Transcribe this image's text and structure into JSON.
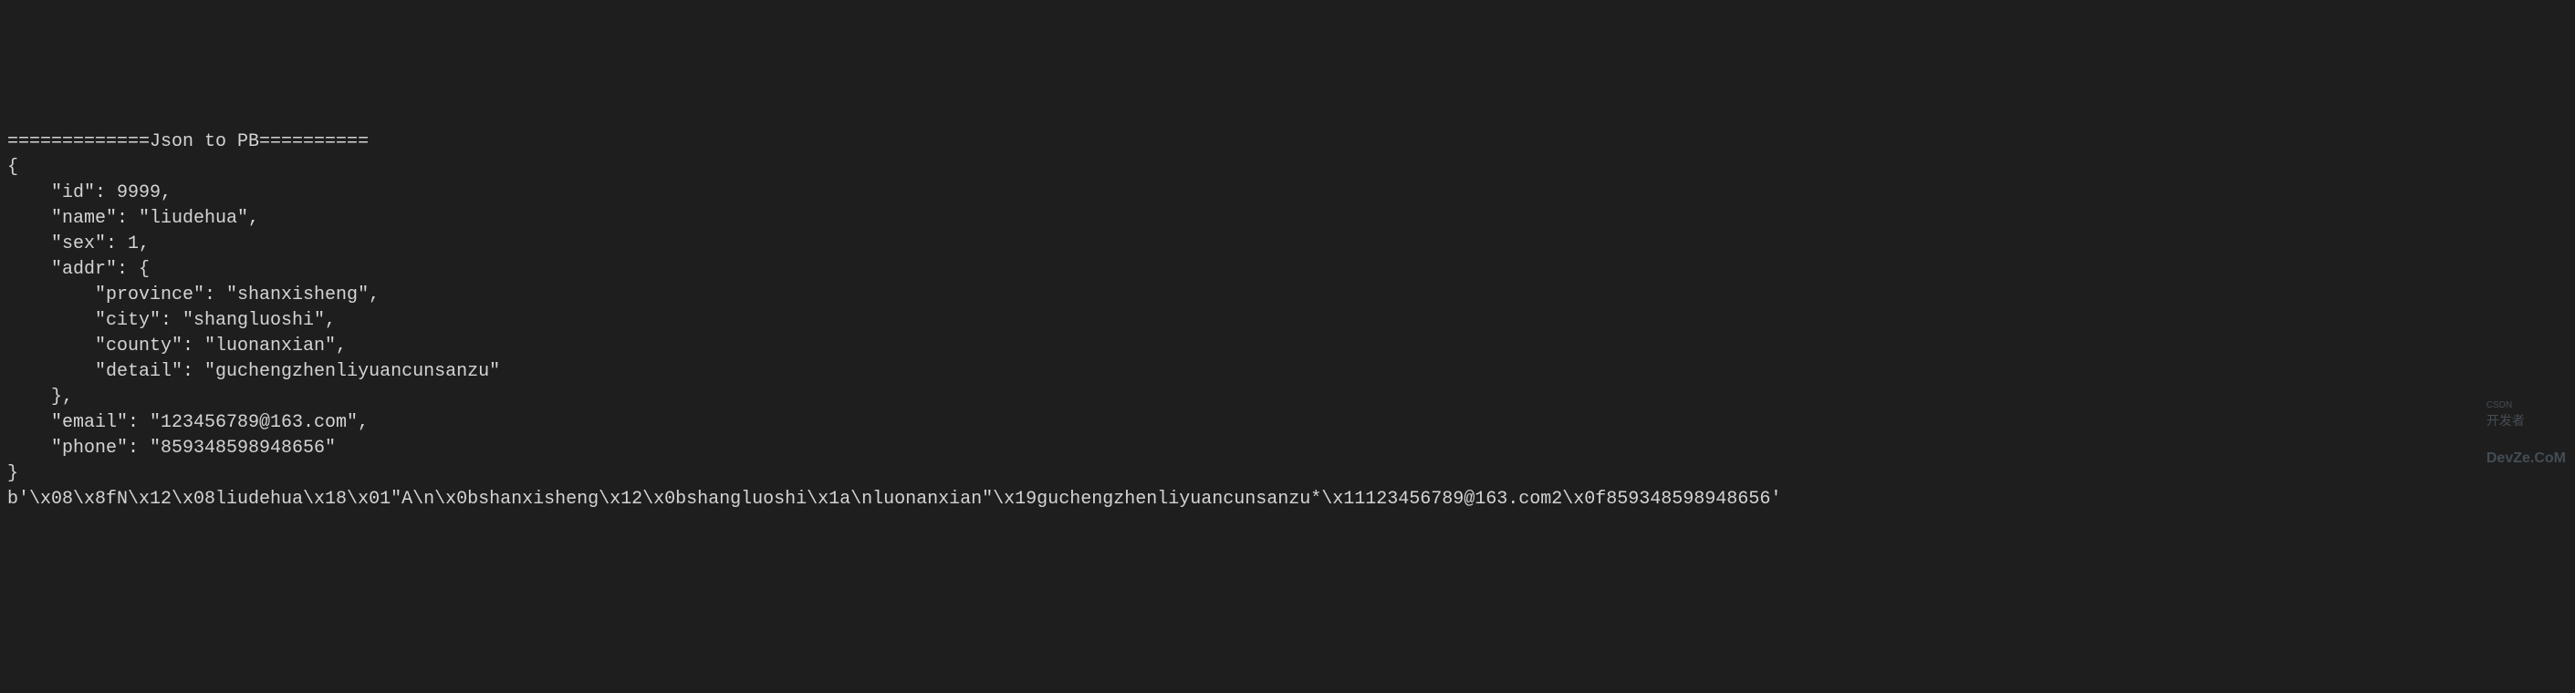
{
  "header": "=============Json to PB==========",
  "json_lines": [
    "{",
    "    \"id\": 9999,",
    "    \"name\": \"liudehua\",",
    "    \"sex\": 1,",
    "    \"addr\": {",
    "        \"province\": \"shanxisheng\",",
    "        \"city\": \"shangluoshi\",",
    "        \"county\": \"luonanxian\",",
    "        \"detail\": \"guchengzhenliyuancunsanzu\"",
    "    },",
    "    \"email\": \"123456789@163.com\",",
    "    \"phone\": \"859348598948656\"",
    "}"
  ],
  "bytes_output": "b'\\x08\\x8fN\\x12\\x08liudehua\\x18\\x01\"A\\n\\x0bshanxisheng\\x12\\x0bshangluoshi\\x1a\\nluonanxian\"\\x19guchengzhenliyuancunsanzu*\\x11123456789@163.com2\\x0f859348598948656'",
  "watermark_small": "CSDN",
  "watermark_text": "开发者",
  "watermark_brand": "DevZe.CoM"
}
